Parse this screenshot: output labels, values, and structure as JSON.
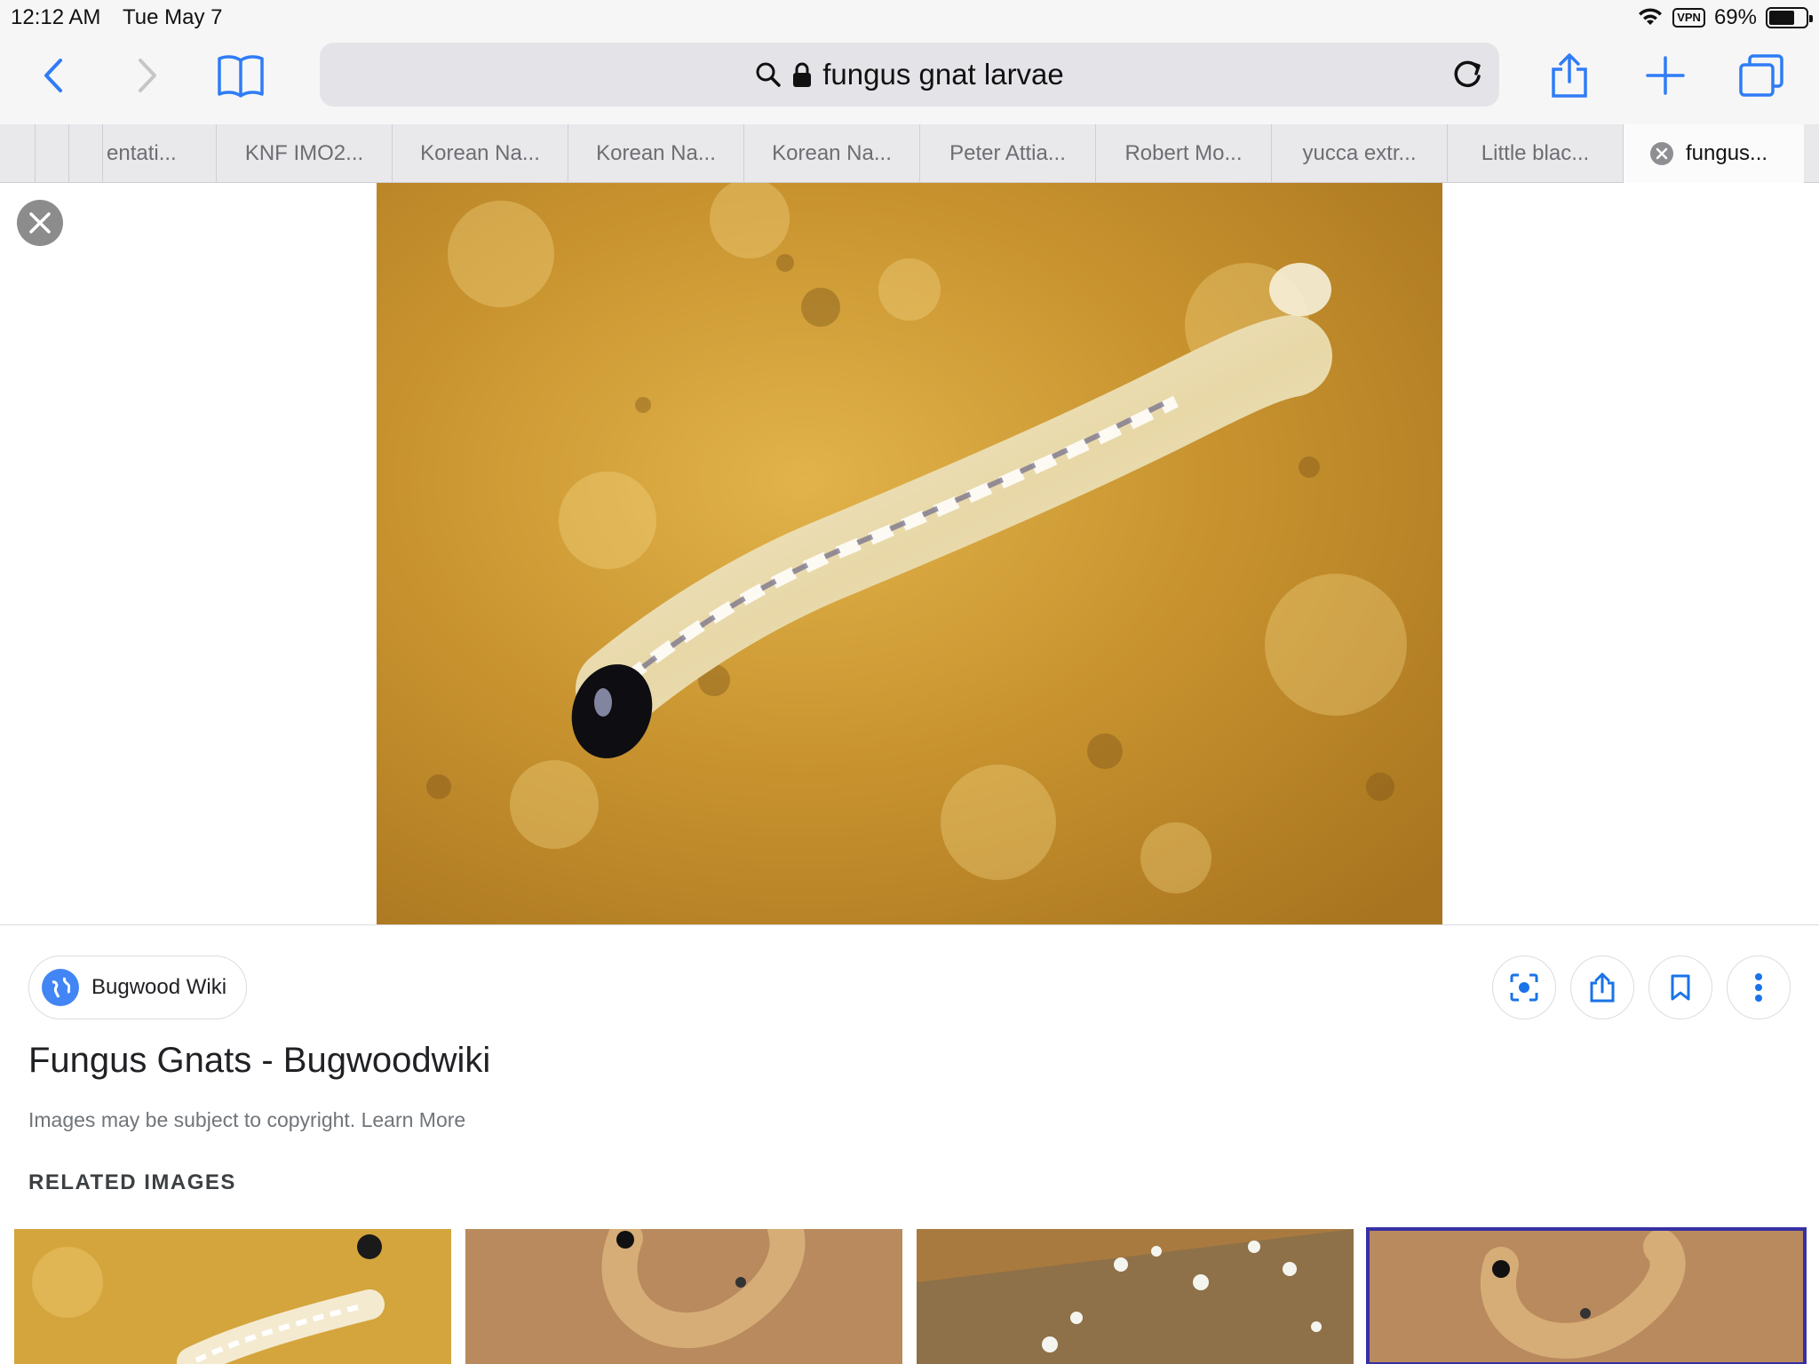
{
  "status": {
    "time": "12:12 AM",
    "date": "Tue May 7",
    "vpn": "VPN",
    "battery": "69%",
    "battery_level": 0.69
  },
  "toolbar": {
    "address_text": "fungus gnat larvae",
    "icons": [
      "back-icon",
      "forward-icon",
      "bookmarks-icon",
      "search-icon",
      "lock-icon",
      "reload-icon",
      "share-icon",
      "plus-icon",
      "tabs-icon"
    ]
  },
  "tabs": [
    {
      "label": "entati..."
    },
    {
      "label": "KNF IMO2..."
    },
    {
      "label": "Korean Na..."
    },
    {
      "label": "Korean Na..."
    },
    {
      "label": "Korean Na..."
    },
    {
      "label": "Peter Attia..."
    },
    {
      "label": "Robert Mo..."
    },
    {
      "label": "yucca extr..."
    },
    {
      "label": "Little blac..."
    },
    {
      "label": "fungus...",
      "active": true
    }
  ],
  "result": {
    "source": "Bugwood Wiki",
    "title": "Fungus Gnats - Bugwoodwiki",
    "copyright": "Images may be subject to copyright. Learn More",
    "related_heading": "RELATED IMAGES"
  },
  "colors": {
    "accent": "#1a73e8",
    "ios_blue": "#2f7cf6",
    "chrome_bg": "#f6f6f7",
    "address_bg": "#e4e4e8"
  }
}
